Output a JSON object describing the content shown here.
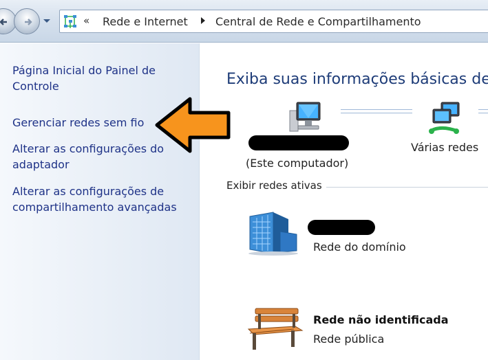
{
  "address_bar": {
    "overflow": "«",
    "breadcrumbs": [
      "Rede e Internet",
      "Central de Rede e Compartilhamento"
    ]
  },
  "left_nav": {
    "items": [
      {
        "label": "Página Inicial do Painel de Controle"
      },
      {
        "label": "Gerenciar redes sem fio"
      },
      {
        "label": "Alterar as configurações do adaptador"
      },
      {
        "label": "Alterar as configurações de compartilhamento avançadas"
      }
    ]
  },
  "main": {
    "title": "Exiba suas informações básicas de",
    "map": {
      "networks_label": "Várias redes",
      "this_computer_label": "(Este computador)"
    },
    "active_networks_label": "Exibir redes ativas",
    "networks": [
      {
        "type_label": "Rede do domínio",
        "icon": "building-icon"
      },
      {
        "name": "Rede não identificada",
        "type_label": "Rede pública",
        "icon": "bench-icon"
      }
    ]
  },
  "annotation": {
    "arrow_color": "#f7941d",
    "outline_color": "#000000"
  },
  "colors": {
    "link": "#1e3287",
    "title": "#1e3c78"
  }
}
